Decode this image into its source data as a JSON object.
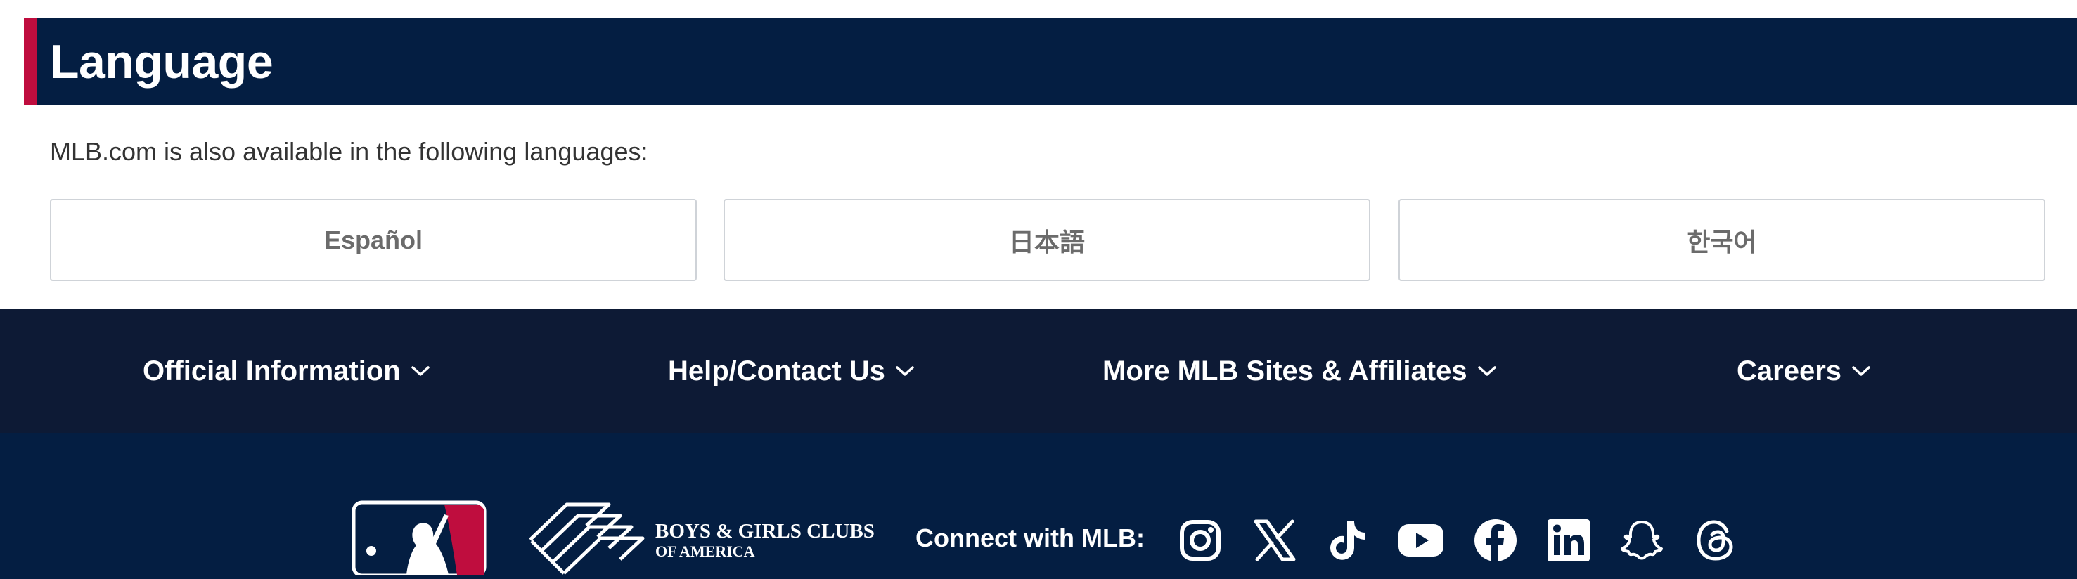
{
  "language_section": {
    "title": "Language",
    "intro": "MLB.com is also available in the following languages:",
    "buttons": [
      "Español",
      "日本語",
      "한국어"
    ]
  },
  "footer_nav": {
    "items": [
      {
        "label": "Official Information",
        "icon": "chevron-down-icon"
      },
      {
        "label": "Help/Contact Us",
        "icon": "chevron-down-icon"
      },
      {
        "label": "More MLB Sites & Affiliates",
        "icon": "chevron-down-icon"
      },
      {
        "label": "Careers",
        "icon": "chevron-down-icon"
      }
    ]
  },
  "footer_bottom": {
    "bgc_line1": "BOYS & GIRLS CLUBS",
    "bgc_line2": "OF AMERICA",
    "connect_label": "Connect with MLB:",
    "social": [
      "instagram-icon",
      "x-icon",
      "tiktok-icon",
      "youtube-icon",
      "facebook-icon",
      "linkedin-icon",
      "snapchat-icon",
      "threads-icon"
    ]
  },
  "colors": {
    "navy": "#041e42",
    "dark_navy": "#0d1a35",
    "red": "#bf0d3e",
    "white": "#ffffff"
  }
}
